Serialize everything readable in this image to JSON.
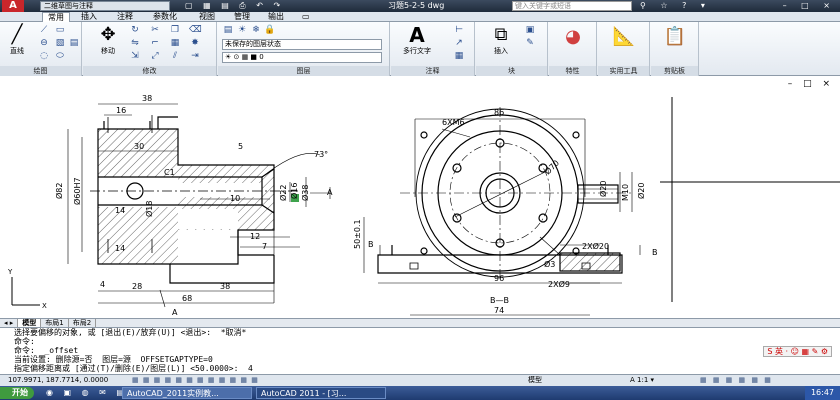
{
  "titlebar": {
    "logo_letter": "A",
    "workspace": "二维草图与注释",
    "quick_access": "▢ ▦ ▤ ⎙ ↶ ↷",
    "document": "习题5-2-5 dwg",
    "search_placeholder": "键入关键字或短语",
    "help_icons": "⚲ ☆ ? ▾",
    "window_controls": "– □ ×"
  },
  "tabs": [
    "常用",
    "插入",
    "注释",
    "参数化",
    "视图",
    "管理",
    "输出",
    "▭"
  ],
  "ribbon": {
    "draw": {
      "line": "直线",
      "label": "绘图"
    },
    "modify": {
      "move": "移动",
      "label": "修改"
    },
    "layers": {
      "state": "未保存的图层状态",
      "current": "☀ ⊙ ▦ ■ 0",
      "label": "图层"
    },
    "annotation": {
      "mtext": "多行文字",
      "label": "注释"
    },
    "block": {
      "insert": "插入",
      "label": "块"
    },
    "properties": {
      "label": "特性"
    },
    "utilities": {
      "label": "实用工具"
    },
    "clipboard": {
      "label": "剪贴板"
    }
  },
  "viewport_controls": "– □ ×",
  "drawing": {
    "left": {
      "dims_top": [
        "38",
        "16",
        "30",
        "5",
        "73°",
        "C1"
      ],
      "dims_vertical": [
        "Ø82",
        "Ø60H7",
        "Ø18",
        "Ø22",
        "Ø16",
        "Ø38"
      ],
      "dims_inner": [
        "14",
        "14",
        "10",
        "12",
        "7",
        "A"
      ],
      "dims_bottom": [
        "4",
        "28",
        "38",
        "68",
        "A"
      ]
    },
    "right": {
      "dims_top": [
        "86",
        "6XM6",
        "Ø70"
      ],
      "dims_side": [
        "Ø20",
        "M10",
        "Ø20",
        "Ø3",
        "50±0.1"
      ],
      "dims_bottom": [
        "2XØ20",
        "2XØ9",
        "96",
        "B—B",
        "74"
      ],
      "section_marks": [
        "B",
        "B"
      ]
    }
  },
  "layout_tabs": [
    "模型",
    "布局1",
    "布局2"
  ],
  "command": {
    "lines": [
      "选择要偏移的对象, 或 [退出(E)/放弃(U)] <退出>:  *取消*",
      "命令:",
      "命令:  _offset",
      "当前设置: 删除源=否  图层=源  OFFSETGAPTYPE=0",
      "指定偏移距离或 [通过(T)/删除(E)/图层(L)] <50.0000>:  4"
    ]
  },
  "ime": "S 英 · ☺ ▦ ✎ ⚙",
  "status": {
    "coords": "107.9971, 187.7714, 0.0000",
    "toggles": "▦ ▦ ▦ ▦ ▦ ▦ ▦ ▦ ▦ ▦ ▦ ▦",
    "model": "模型",
    "scale": "A 1:1 ▾",
    "right_icons": "▦ ▦ ▦ ▦ ▦ ▦"
  },
  "taskbar": {
    "start": "开始",
    "tasks": [
      "AutoCAD_2011实例教...",
      "AutoCAD 2011 - [习..."
    ],
    "clock": "16:47"
  }
}
